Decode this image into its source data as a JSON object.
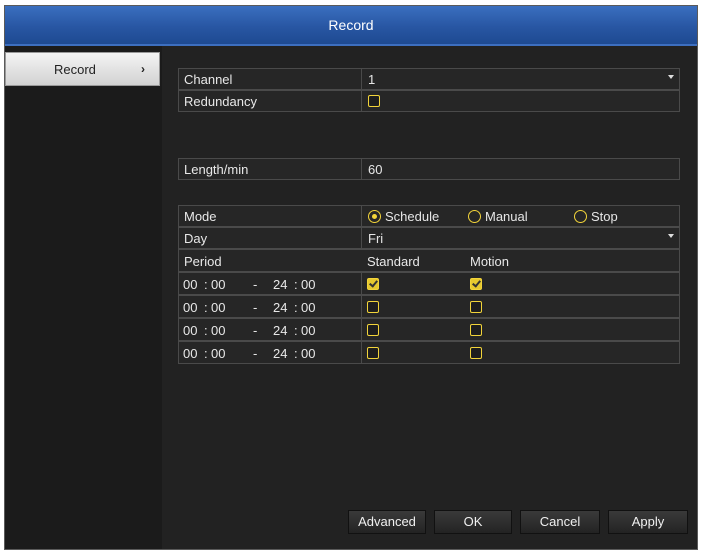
{
  "window": {
    "title": "Record"
  },
  "sidebar": {
    "items": [
      {
        "label": "Record"
      }
    ]
  },
  "form": {
    "channel": {
      "label": "Channel",
      "value": "1"
    },
    "redundancy": {
      "label": "Redundancy",
      "checked": false
    },
    "length": {
      "label": "Length/min",
      "value": "60"
    },
    "mode": {
      "label": "Mode",
      "options": [
        "Schedule",
        "Manual",
        "Stop"
      ],
      "selected": "Schedule"
    },
    "day": {
      "label": "Day",
      "value": "Fri"
    },
    "period": {
      "label": "Period",
      "col_standard": "Standard",
      "col_motion": "Motion",
      "rows": [
        {
          "start_h": "00",
          "start_m": "00",
          "sep": "-",
          "end_h": "24",
          "end_m": "00",
          "standard": true,
          "motion": true
        },
        {
          "start_h": "00",
          "start_m": "00",
          "sep": "-",
          "end_h": "24",
          "end_m": "00",
          "standard": false,
          "motion": false
        },
        {
          "start_h": "00",
          "start_m": "00",
          "sep": "-",
          "end_h": "24",
          "end_m": "00",
          "standard": false,
          "motion": false
        },
        {
          "start_h": "00",
          "start_m": "00",
          "sep": "-",
          "end_h": "24",
          "end_m": "00",
          "standard": false,
          "motion": false
        }
      ]
    }
  },
  "buttons": {
    "advanced": "Advanced",
    "ok": "OK",
    "cancel": "Cancel",
    "apply": "Apply"
  },
  "colors": {
    "titlebar": "#2856a3",
    "accent": "#f2d43a",
    "panel": "#222222"
  }
}
